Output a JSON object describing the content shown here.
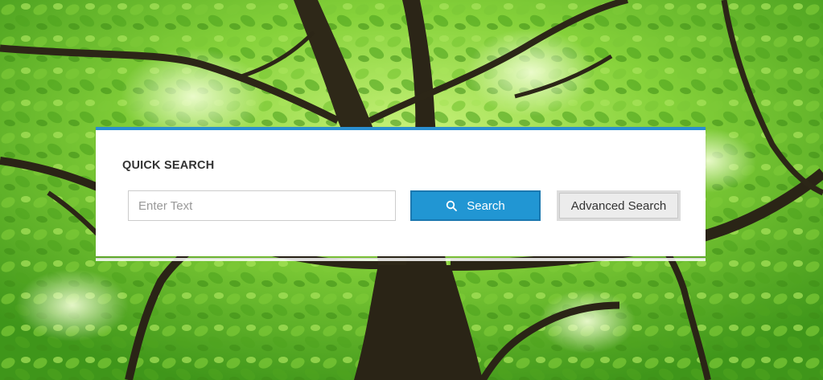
{
  "quick_search": {
    "title": "QUICK SEARCH",
    "input_placeholder": "Enter Text",
    "input_value": "",
    "search_button_label": "Search",
    "search_icon": "search-icon",
    "advanced_button_label": "Advanced Search"
  },
  "background": {
    "image": "green tree canopy photo",
    "colors": {
      "foliage_light": "#9be04a",
      "foliage_mid": "#5fb524",
      "foliage_dark": "#2e7a12",
      "bark": "#2a2416"
    }
  },
  "colors": {
    "accent": "#2a8fd0",
    "search_button": "#2196d3",
    "advanced_button": "#ececec"
  }
}
